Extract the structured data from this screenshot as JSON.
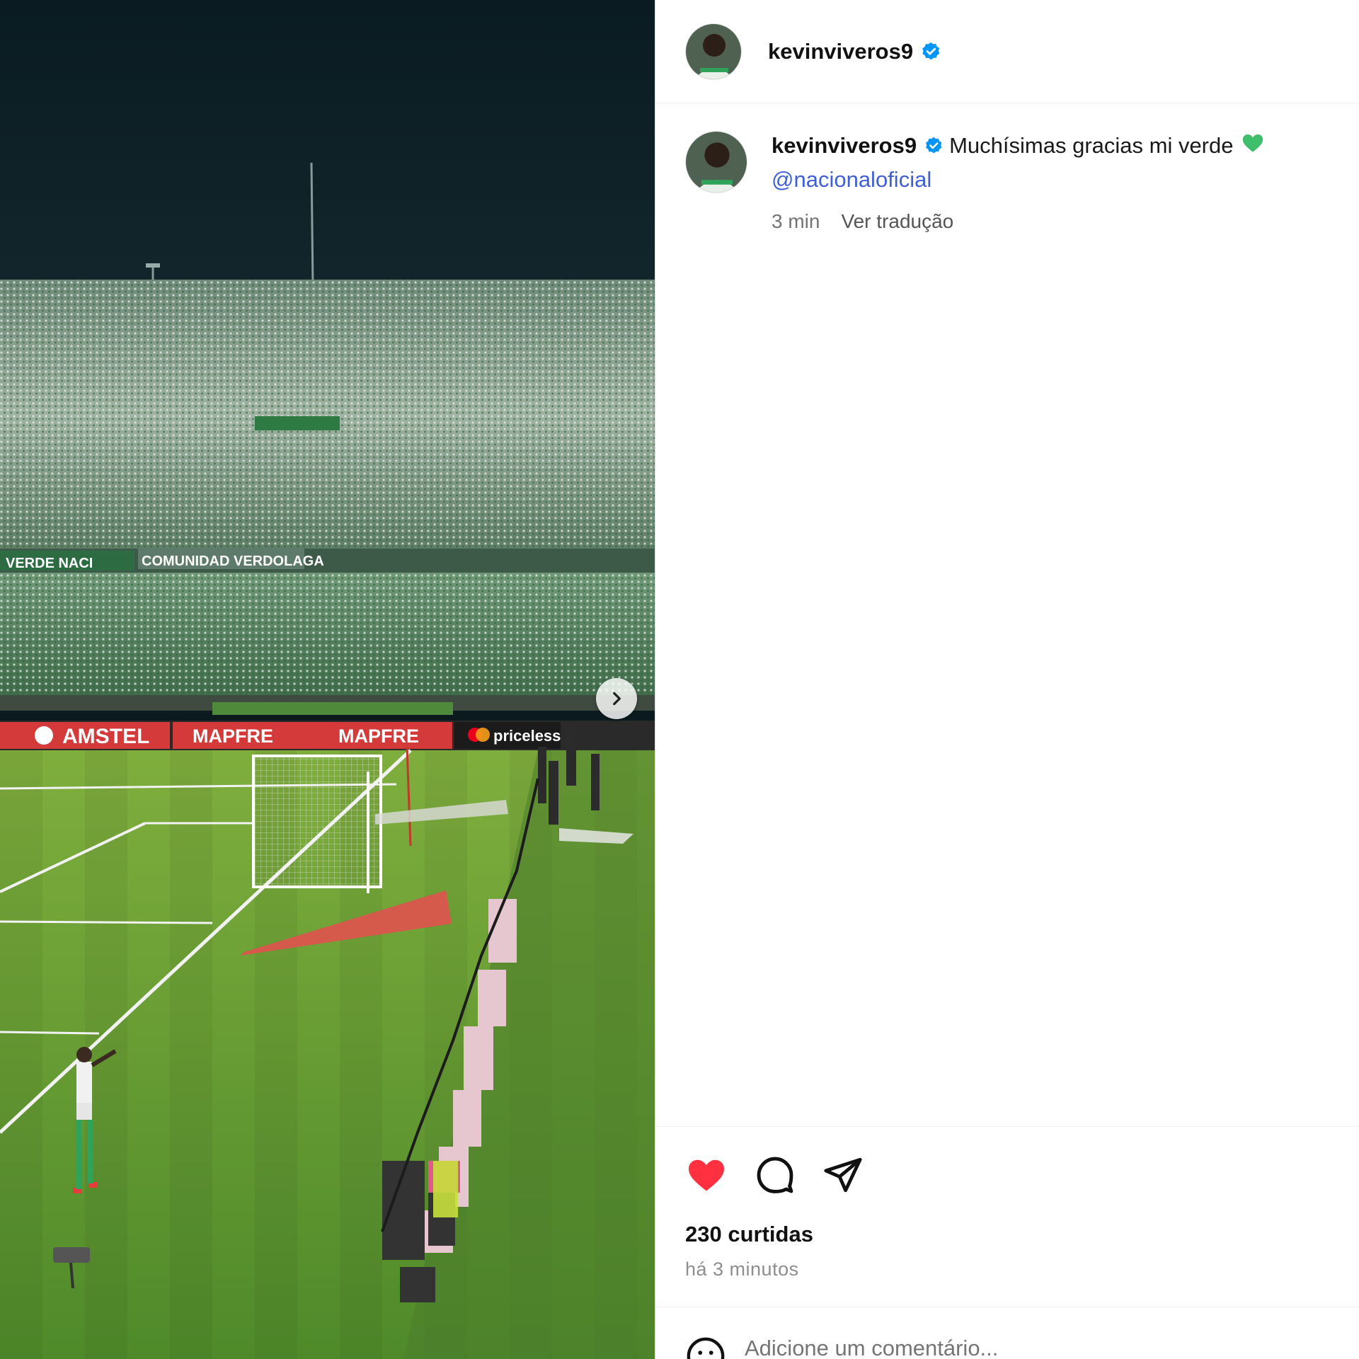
{
  "post": {
    "username": "kevinviveros9",
    "verified": true,
    "caption_text": "Muchísimas gracias mi verde",
    "caption_emoji": "green-heart",
    "mention": "@nacionaloficial",
    "time_short": "3 min",
    "translate_label": "Ver tradução",
    "likes": "230 curtidas",
    "time_long": "há 3 minutos",
    "liked": true
  },
  "comment": {
    "placeholder": "Adicione um comentário..."
  },
  "media": {
    "description_banners": [
      "AMSTEL",
      "MAPFRE",
      "MAPFRE",
      "priceless"
    ],
    "stand_banner": "COMUNIDAD VERDOLAGA",
    "stand_banner_left": "VERDE NACI"
  },
  "colors": {
    "accent_link": "#3f5fd9",
    "like_red": "#ff3040",
    "verified_blue": "#0095f6"
  }
}
